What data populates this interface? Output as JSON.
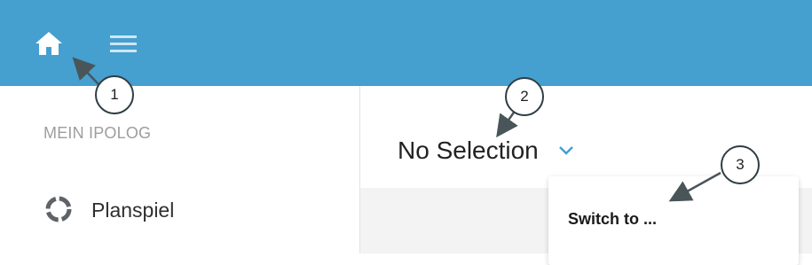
{
  "icons": {
    "home": "home-icon",
    "menu": "hamburger-menu-icon",
    "planspiel": "progress-ring-icon",
    "dropdown": "chevron-down-icon"
  },
  "colors": {
    "topbar": "#459fcf",
    "accent": "#459fcf",
    "callout_border": "#2e3d44"
  },
  "sidebar": {
    "title": "MEIN IPOLOG",
    "items": [
      {
        "label": "Planspiel"
      }
    ]
  },
  "main": {
    "selection_label": "No Selection"
  },
  "popup": {
    "item_label": "Switch to ..."
  },
  "callouts": [
    "1",
    "2",
    "3"
  ]
}
